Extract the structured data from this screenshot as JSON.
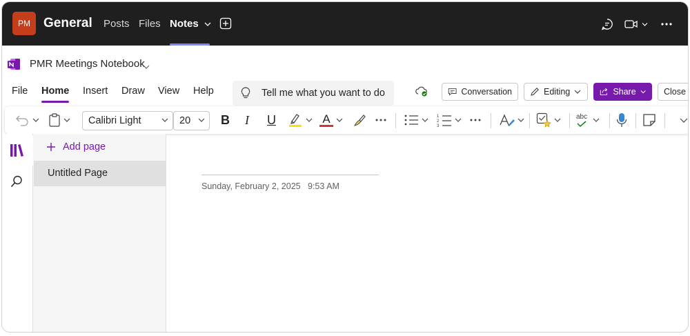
{
  "teams_bar": {
    "avatar_initials": "PM",
    "team_name": "General",
    "tabs": [
      {
        "label": "Posts"
      },
      {
        "label": "Files"
      },
      {
        "label": "Notes",
        "active": true
      }
    ],
    "icons": [
      "add-tab-icon",
      "chat-icon",
      "video-call-icon",
      "more-icon"
    ]
  },
  "notebook": {
    "title": "PMR Meetings Notebook"
  },
  "menu": {
    "items": [
      "File",
      "Home",
      "Insert",
      "Draw",
      "View",
      "Help"
    ],
    "active": "Home",
    "tell_me": "Tell me what you want to do"
  },
  "header_buttons": {
    "conversation": "Conversation",
    "editing": "Editing",
    "share": "Share",
    "close": "Close"
  },
  "ribbon": {
    "font_name": "Calibri Light",
    "font_size": "20",
    "bold": "B",
    "italic": "I",
    "underline": "U",
    "font_color_letter": "A",
    "spelling_label": "abc"
  },
  "sidebar": {
    "add_page": "Add page",
    "pages": [
      {
        "title": "Untitled Page",
        "selected": true
      }
    ]
  },
  "page": {
    "date": "Sunday, February 2, 2025",
    "time": "9:53 AM"
  },
  "colors": {
    "teams_bar": "#1f1f1f",
    "team_avatar": "#c43e1c",
    "tab_underline": "#7f85f5",
    "onenote_purple": "#7719aa",
    "highlight_yellow": "#f5e300",
    "font_red": "#d13438"
  }
}
